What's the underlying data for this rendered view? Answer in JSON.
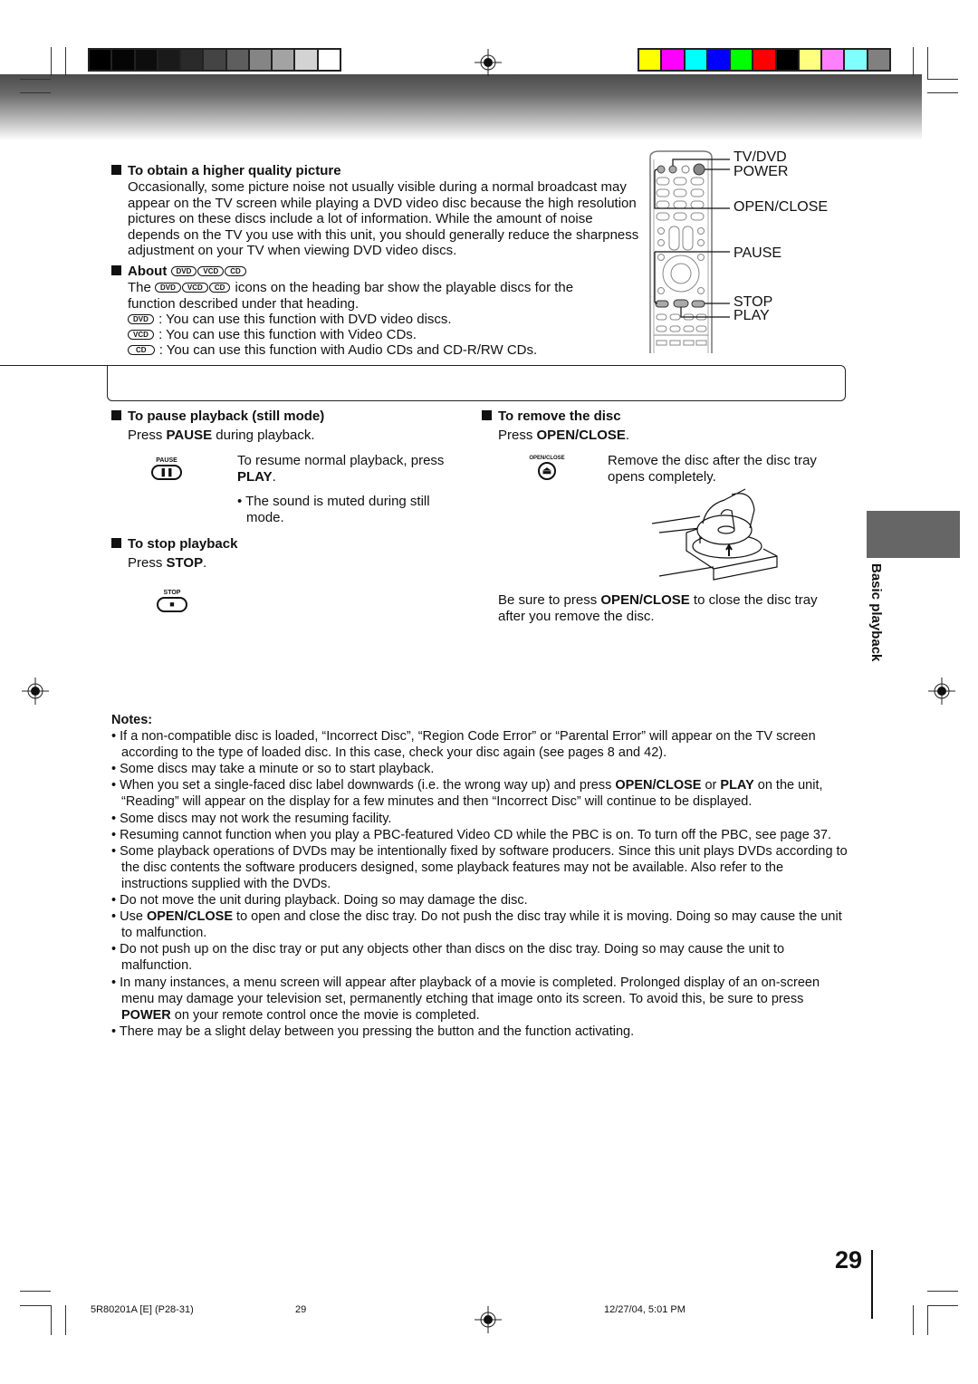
{
  "colors": {
    "grayscale": [
      "#000000",
      "#050505",
      "#0d0d0d",
      "#1a1a1a",
      "#2a2a2a",
      "#444444",
      "#5e5e5e",
      "#858585",
      "#a3a3a3",
      "#d3d3d3",
      "#ffffff"
    ],
    "color_bar": [
      "#ffff00",
      "#ff00ff",
      "#00ffff",
      "#0000ff",
      "#00ff00",
      "#ff0000",
      "#000000",
      "#ffff80",
      "#ff80ff",
      "#80ffff",
      "#808080"
    ],
    "tab": "#666666"
  },
  "quality": {
    "heading": "To obtain a higher quality picture",
    "body": "Occasionally, some picture noise not usually visible during a normal broadcast may appear on the TV screen while playing a DVD video disc because the high resolution pictures on these discs include a lot of information. While the amount of noise depends on the TV you use with this unit, you should generally reduce the sharpness adjustment on your TV when viewing DVD video discs."
  },
  "about": {
    "heading": "About",
    "badges": [
      "DVD",
      "VCD",
      "CD"
    ],
    "intro_pre": "The",
    "intro_post": "icons on the heading bar show the playable discs for the function described under that heading.",
    "lines": [
      ": You can use this function with DVD video discs.",
      ": You can use this function with Video CDs.",
      ": You can use this function with Audio CDs and CD-R/RW CDs."
    ]
  },
  "remote_labels": {
    "tvdvd": "TV/DVD",
    "power": "POWER",
    "open_close": "OPEN/CLOSE",
    "pause": "PAUSE",
    "stop": "STOP",
    "play": "PLAY"
  },
  "pause": {
    "heading": "To pause playback (still mode)",
    "press": "Press ",
    "key": "PAUSE",
    "press_post": " during playback.",
    "button_label": "PAUSE",
    "resume": "To resume normal playback, press ",
    "resume_key": "PLAY",
    "resume_post": ".",
    "note": "• The sound is muted during still mode."
  },
  "stop": {
    "heading": "To stop playback",
    "press": "Press ",
    "key": "STOP",
    "post": ".",
    "button_label": "STOP"
  },
  "remove": {
    "heading": "To remove the disc",
    "press": "Press ",
    "key": "OPEN/CLOSE",
    "post": ".",
    "button_label": "OPEN/CLOSE",
    "after": "Remove the disc after the disc tray opens completely.",
    "close_pre": "Be sure to press ",
    "close_key": "OPEN/CLOSE",
    "close_post": " to close the disc tray after you remove the disc."
  },
  "side_tab": "Basic playback",
  "notes": {
    "title": "Notes:",
    "items": [
      [
        "If a non-compatible disc is loaded, “Incorrect Disc”, “Region Code Error” or “Parental Error” will appear on the TV screen according to the type of loaded disc. In this case, check your disc again (see pages 8 and 42)."
      ],
      [
        "Some discs may take a minute or so to start playback."
      ],
      [
        "When you set a single-faced disc label downwards (i.e. the wrong way up) and press ",
        "OPEN/CLOSE",
        " or ",
        "PLAY",
        " on the unit, “Reading” will appear on the display for a few minutes and then “Incorrect Disc” will continue to be displayed."
      ],
      [
        "Some discs may not work the resuming facility."
      ],
      [
        "Resuming cannot function when you play a PBC-featured Video CD while the PBC is on. To turn off the PBC, see page 37."
      ],
      [
        "Some playback operations of DVDs may be intentionally fixed by software producers. Since this unit plays DVDs according to the disc contents the software producers designed, some playback features may not be available. Also refer to the instructions supplied with the DVDs."
      ],
      [
        "Do not move the unit during playback. Doing so may damage the disc."
      ],
      [
        "Use ",
        "OPEN/CLOSE",
        " to open and close the disc tray. Do not push the disc tray while it is moving. Doing so may cause the unit to malfunction."
      ],
      [
        "Do not push up on the disc tray or put any objects other than discs on the disc tray. Doing so may cause the unit to malfunction."
      ],
      [
        "In many instances, a menu screen will appear after playback of a movie is completed. Prolonged display of an on-screen menu may damage your television set, permanently etching that image onto its screen. To avoid this, be sure to press ",
        "POWER",
        " on your remote control once the movie is completed."
      ],
      [
        "There may be a slight delay between you pressing the button and the function activating."
      ]
    ]
  },
  "page_number": "29",
  "footer": {
    "code": "5R80201A [E] (P28-31)",
    "page": "29",
    "date": "12/27/04, 5:01 PM"
  }
}
